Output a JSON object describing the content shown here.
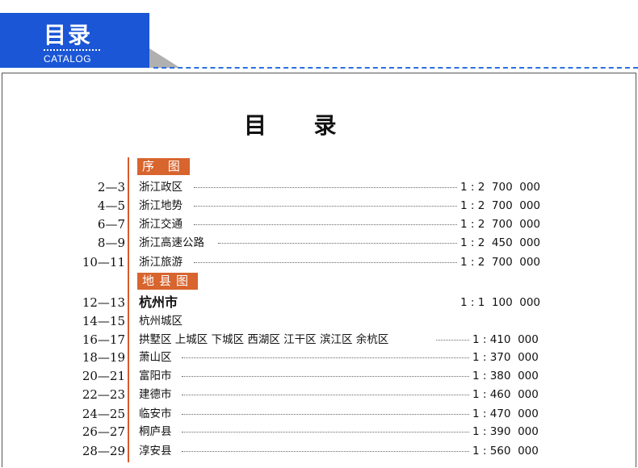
{
  "header": {
    "badge_title": "目录",
    "badge_subtitle": "CATALOG"
  },
  "page_title": "目      录",
  "sections": [
    {
      "heading": "序 图",
      "entries": [
        {
          "pages": "2—3",
          "name": "浙江政区",
          "scale": "1 : 2  700  000"
        },
        {
          "pages": "4—5",
          "name": "浙江地势",
          "scale": "1 : 2  700  000"
        },
        {
          "pages": "6—7",
          "name": "浙江交通",
          "scale": "1 : 2  700  000"
        },
        {
          "pages": "8—9",
          "name": "浙江高速公路",
          "scale": "1 : 2  450  000"
        },
        {
          "pages": "10—11",
          "name": "浙江旅游",
          "scale": "1 : 2  700  000"
        }
      ]
    },
    {
      "heading": "地县图",
      "entries": [
        {
          "pages": "12—13",
          "name": "杭州市",
          "scale": "1 : 1  100  000"
        },
        {
          "pages": "14—15",
          "name": "杭州城区",
          "scale": ""
        },
        {
          "pages": "16—17",
          "name": "拱墅区  上城区  下城区  西湖区  江干区  滨江区  余杭区",
          "scale": "1 : 410  000"
        },
        {
          "pages": "18—19",
          "name": "萧山区",
          "scale": "1 : 370  000"
        },
        {
          "pages": "20—21",
          "name": "富阳市",
          "scale": "1 : 380  000"
        },
        {
          "pages": "22—23",
          "name": "建德市",
          "scale": "1 : 460  000"
        },
        {
          "pages": "24—25",
          "name": "临安市",
          "scale": "1 : 470  000"
        },
        {
          "pages": "26—27",
          "name": "桐庐县",
          "scale": "1 : 390  000"
        },
        {
          "pages": "28—29",
          "name": "淳安县",
          "scale": "1 : 560  000"
        }
      ]
    }
  ]
}
